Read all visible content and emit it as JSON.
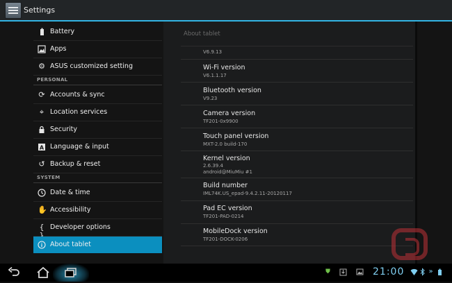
{
  "actionbar": {
    "title": "Settings"
  },
  "sidebar": {
    "items": [
      {
        "label": "Battery",
        "icon": "battery-icon"
      },
      {
        "label": "Apps",
        "icon": "apps-icon"
      },
      {
        "label": "ASUS customized setting",
        "icon": "gear-icon"
      },
      {
        "header": "PERSONAL"
      },
      {
        "label": "Accounts & sync",
        "icon": "sync-icon"
      },
      {
        "label": "Location services",
        "icon": "location-icon"
      },
      {
        "label": "Security",
        "icon": "lock-icon"
      },
      {
        "label": "Language & input",
        "icon": "language-icon"
      },
      {
        "label": "Backup & reset",
        "icon": "backup-icon"
      },
      {
        "header": "SYSTEM"
      },
      {
        "label": "Date & time",
        "icon": "clock-icon"
      },
      {
        "label": "Accessibility",
        "icon": "hand-icon"
      },
      {
        "label": "Developer options",
        "icon": "braces-icon"
      },
      {
        "label": "About tablet",
        "icon": "info-icon",
        "selected": true
      }
    ]
  },
  "about": {
    "title": "About tablet",
    "rows": [
      {
        "subs": [
          "V6.9.13"
        ]
      },
      {
        "title": "Wi-Fi version",
        "subs": [
          "V6.1.1.17"
        ]
      },
      {
        "title": "Bluetooth version",
        "subs": [
          "V9.23"
        ]
      },
      {
        "title": "Camera version",
        "subs": [
          "TF201-0x9900"
        ]
      },
      {
        "title": "Touch panel version",
        "subs": [
          "MXT-2.0 build-170"
        ]
      },
      {
        "title": "Kernel version",
        "subs": [
          "2.6.39.4",
          "android@MiuMiu #1"
        ]
      },
      {
        "title": "Build number",
        "subs": [
          "IML74K.US_epad-9.4.2.11-20120117"
        ]
      },
      {
        "title": "Pad EC version",
        "subs": [
          "TF201-PAD-0214"
        ]
      },
      {
        "title": "MobileDock version",
        "subs": [
          "TF201-DOCK-0206"
        ]
      }
    ]
  },
  "navbar": {
    "buttons": [
      "back-icon",
      "home-icon",
      "recent-apps-icon"
    ],
    "status": {
      "time": "21:00",
      "icons": [
        "shield-icon",
        "download-icon",
        "image-icon",
        "wifi-icon",
        "bluetooth-icon",
        "chevron-right-icon",
        "battery-icon"
      ]
    }
  },
  "colors": {
    "accent": "#33b5e5",
    "selected": "#0b8fbf"
  }
}
